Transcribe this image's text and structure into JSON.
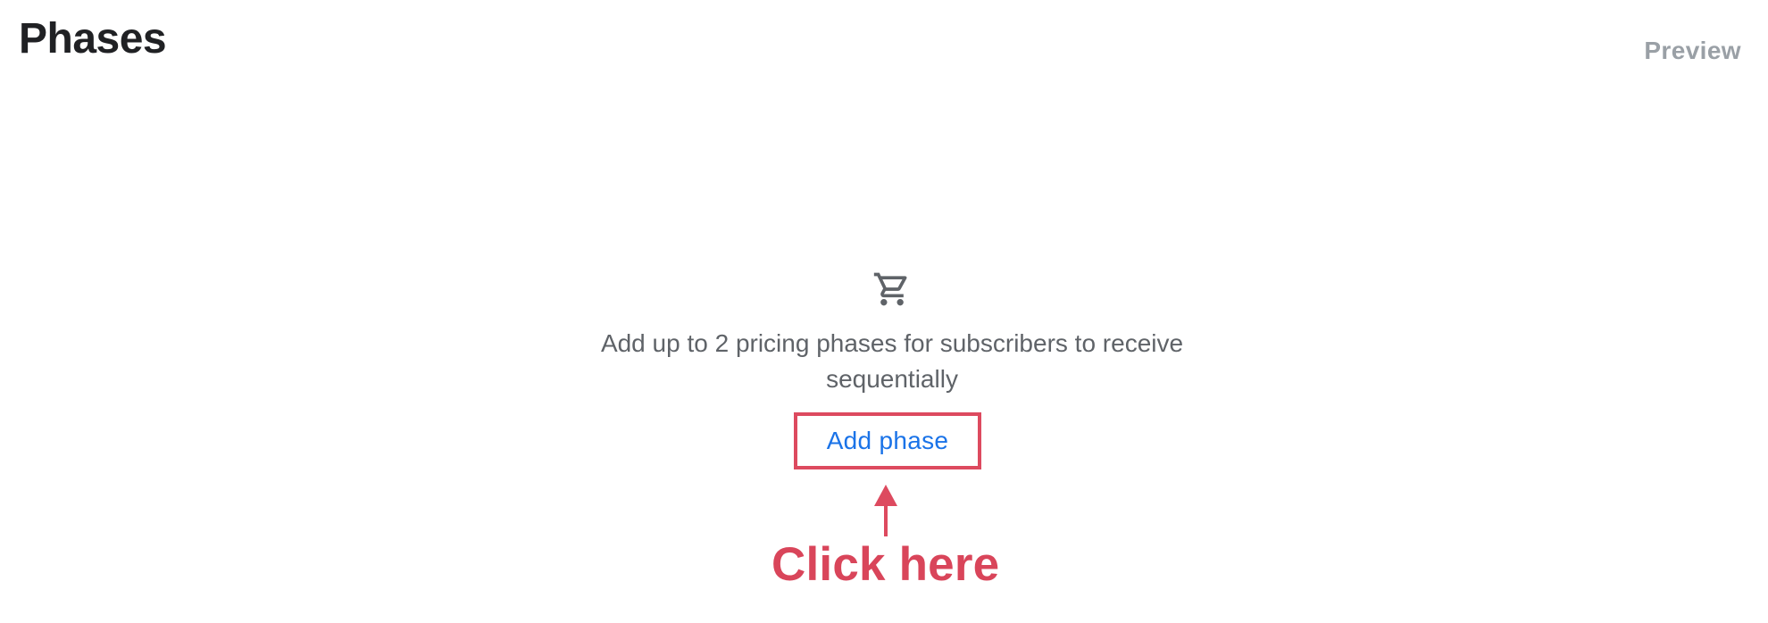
{
  "header": {
    "title": "Phases",
    "preview_label": "Preview"
  },
  "empty_state": {
    "icon": "shopping-cart-icon",
    "message": "Add up to 2 pricing phases for subscribers to receive sequentially",
    "button_label": "Add phase"
  },
  "annotation": {
    "callout_text": "Click here",
    "color": "#dd4a5f"
  },
  "colors": {
    "title": "#202124",
    "link_blue": "#1a73e8",
    "muted_gray": "#9aa0a6",
    "body_gray": "#5f6368"
  }
}
